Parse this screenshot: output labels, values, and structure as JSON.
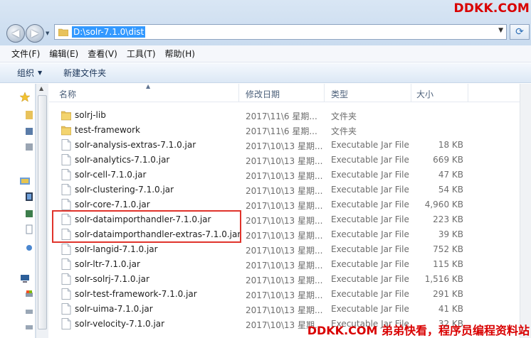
{
  "window": {
    "address_path": "D:\\solr-7.1.0\\dist",
    "watermark_top": "DDKK.COM",
    "watermark_bottom": "DDKK.COM 弟弟快看，程序员编程资料站"
  },
  "menu": {
    "items": [
      "文件(F)",
      "编辑(E)",
      "查看(V)",
      "工具(T)",
      "帮助(H)"
    ]
  },
  "toolbar": {
    "organize_label": "组织",
    "new_folder_label": "新建文件夹"
  },
  "columns": {
    "name": "名称",
    "date": "修改日期",
    "type": "类型",
    "size": "大小"
  },
  "files": [
    {
      "name": "solrj-lib",
      "date": "2017\\11\\6 星期...",
      "type": "文件夹",
      "size": "",
      "kind": "folder"
    },
    {
      "name": "test-framework",
      "date": "2017\\11\\6 星期...",
      "type": "文件夹",
      "size": "",
      "kind": "folder"
    },
    {
      "name": "solr-analysis-extras-7.1.0.jar",
      "date": "2017\\10\\13 星期...",
      "type": "Executable Jar File",
      "size": "18 KB",
      "kind": "jar"
    },
    {
      "name": "solr-analytics-7.1.0.jar",
      "date": "2017\\10\\13 星期...",
      "type": "Executable Jar File",
      "size": "669 KB",
      "kind": "jar"
    },
    {
      "name": "solr-cell-7.1.0.jar",
      "date": "2017\\10\\13 星期...",
      "type": "Executable Jar File",
      "size": "47 KB",
      "kind": "jar"
    },
    {
      "name": "solr-clustering-7.1.0.jar",
      "date": "2017\\10\\13 星期...",
      "type": "Executable Jar File",
      "size": "54 KB",
      "kind": "jar"
    },
    {
      "name": "solr-core-7.1.0.jar",
      "date": "2017\\10\\13 星期...",
      "type": "Executable Jar File",
      "size": "4,960 KB",
      "kind": "jar"
    },
    {
      "name": "solr-dataimporthandler-7.1.0.jar",
      "date": "2017\\10\\13 星期...",
      "type": "Executable Jar File",
      "size": "223 KB",
      "kind": "jar"
    },
    {
      "name": "solr-dataimporthandler-extras-7.1.0.jar",
      "date": "2017\\10\\13 星期...",
      "type": "Executable Jar File",
      "size": "39 KB",
      "kind": "jar"
    },
    {
      "name": "solr-langid-7.1.0.jar",
      "date": "2017\\10\\13 星期...",
      "type": "Executable Jar File",
      "size": "752 KB",
      "kind": "jar"
    },
    {
      "name": "solr-ltr-7.1.0.jar",
      "date": "2017\\10\\13 星期...",
      "type": "Executable Jar File",
      "size": "115 KB",
      "kind": "jar"
    },
    {
      "name": "solr-solrj-7.1.0.jar",
      "date": "2017\\10\\13 星期...",
      "type": "Executable Jar File",
      "size": "1,516 KB",
      "kind": "jar"
    },
    {
      "name": "solr-test-framework-7.1.0.jar",
      "date": "2017\\10\\13 星期...",
      "type": "Executable Jar File",
      "size": "291 KB",
      "kind": "jar"
    },
    {
      "name": "solr-uima-7.1.0.jar",
      "date": "2017\\10\\13 星期...",
      "type": "Executable Jar File",
      "size": "41 KB",
      "kind": "jar"
    },
    {
      "name": "solr-velocity-7.1.0.jar",
      "date": "2017\\10\\13 星期...",
      "type": "Executable Jar File",
      "size": "32 KB",
      "kind": "jar"
    }
  ],
  "colors": {
    "highlight_box": "#e0332b",
    "watermark": "#d90000",
    "address_selection": "#3399ff"
  }
}
